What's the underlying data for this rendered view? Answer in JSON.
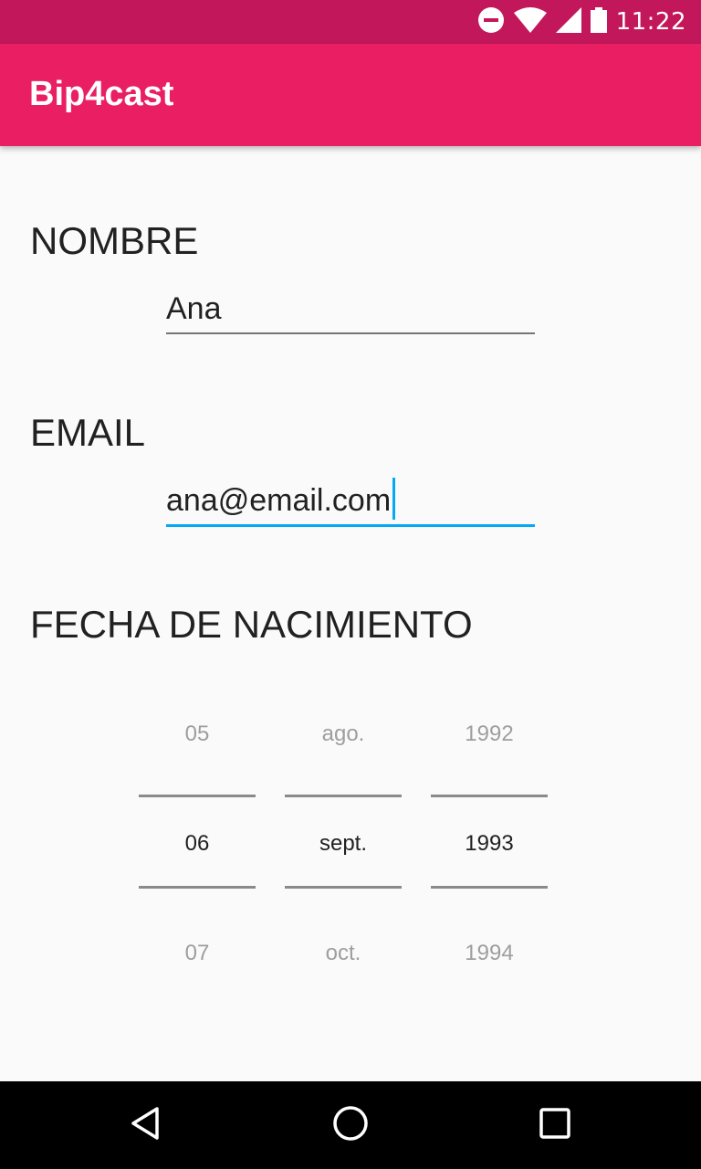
{
  "status_bar": {
    "time": "11:22",
    "icons": [
      "do-not-disturb-icon",
      "wifi-icon",
      "cell-signal-icon",
      "battery-icon"
    ]
  },
  "app_bar": {
    "title": "Bip4cast",
    "color": "#e91e63"
  },
  "form": {
    "nombre": {
      "label": "NOMBRE",
      "value": "Ana"
    },
    "email": {
      "label": "EMAIL",
      "value": "ana@email.com"
    },
    "fecha": {
      "label": "FECHA DE NACIMIENTO",
      "day": {
        "prev": "05",
        "selected": "06",
        "next": "07"
      },
      "month": {
        "prev": "ago.",
        "selected": "sept.",
        "next": "oct."
      },
      "year": {
        "prev": "1992",
        "selected": "1993",
        "next": "1994"
      }
    }
  },
  "nav_bar": {
    "buttons": [
      "back-icon",
      "home-icon",
      "recents-icon"
    ]
  },
  "colors": {
    "status_bar": "#c2185b",
    "accent": "#03a9f4"
  }
}
